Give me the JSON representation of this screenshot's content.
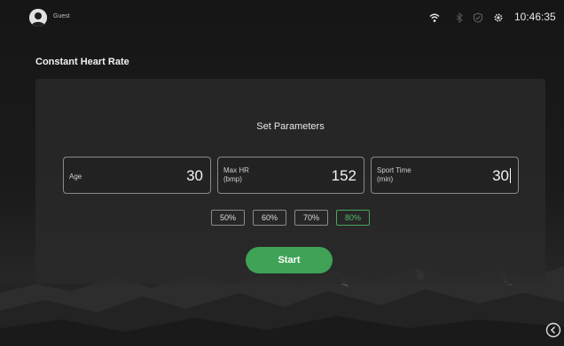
{
  "status_bar": {
    "user_name": "Guest",
    "icons": [
      "wifi-icon",
      "bluetooth-icon",
      "shield-icon",
      "settings-gear-icon"
    ],
    "time": "10:46:35"
  },
  "page": {
    "title": "Constant Heart Rate"
  },
  "panel": {
    "title": "Set Parameters",
    "fields": [
      {
        "label": "Age",
        "value": "30"
      },
      {
        "label": "Max HR",
        "sublabel": "(bmp)",
        "value": "152"
      },
      {
        "label": "Sport Time",
        "sublabel": "(min)",
        "value": "30"
      }
    ],
    "percent_options": [
      "50%",
      "60%",
      "70%",
      "80%"
    ],
    "selected_percent": "80%",
    "start_label": "Start"
  },
  "colors": {
    "accent": "#3fa257",
    "selected": "#4fbf6a"
  }
}
